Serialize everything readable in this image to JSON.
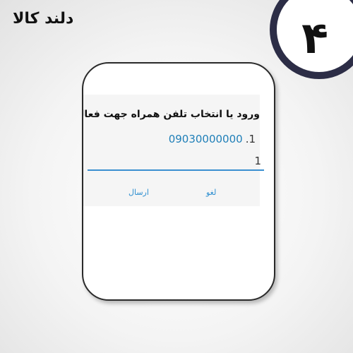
{
  "brand": {
    "name": "دلند کالا"
  },
  "step": {
    "number": "۴"
  },
  "dialog": {
    "title": "ورود یا انتخاب  تلفن همراه جهت فعال سازی",
    "option": {
      "index": ".1",
      "phone": "09030000000"
    },
    "input_value": "1",
    "buttons": {
      "cancel": "لغو",
      "send": "ارسال"
    }
  },
  "colors": {
    "accent": "#2e8fd0",
    "badge_ring": "#2c2d46",
    "background": "#f4f4f4"
  }
}
